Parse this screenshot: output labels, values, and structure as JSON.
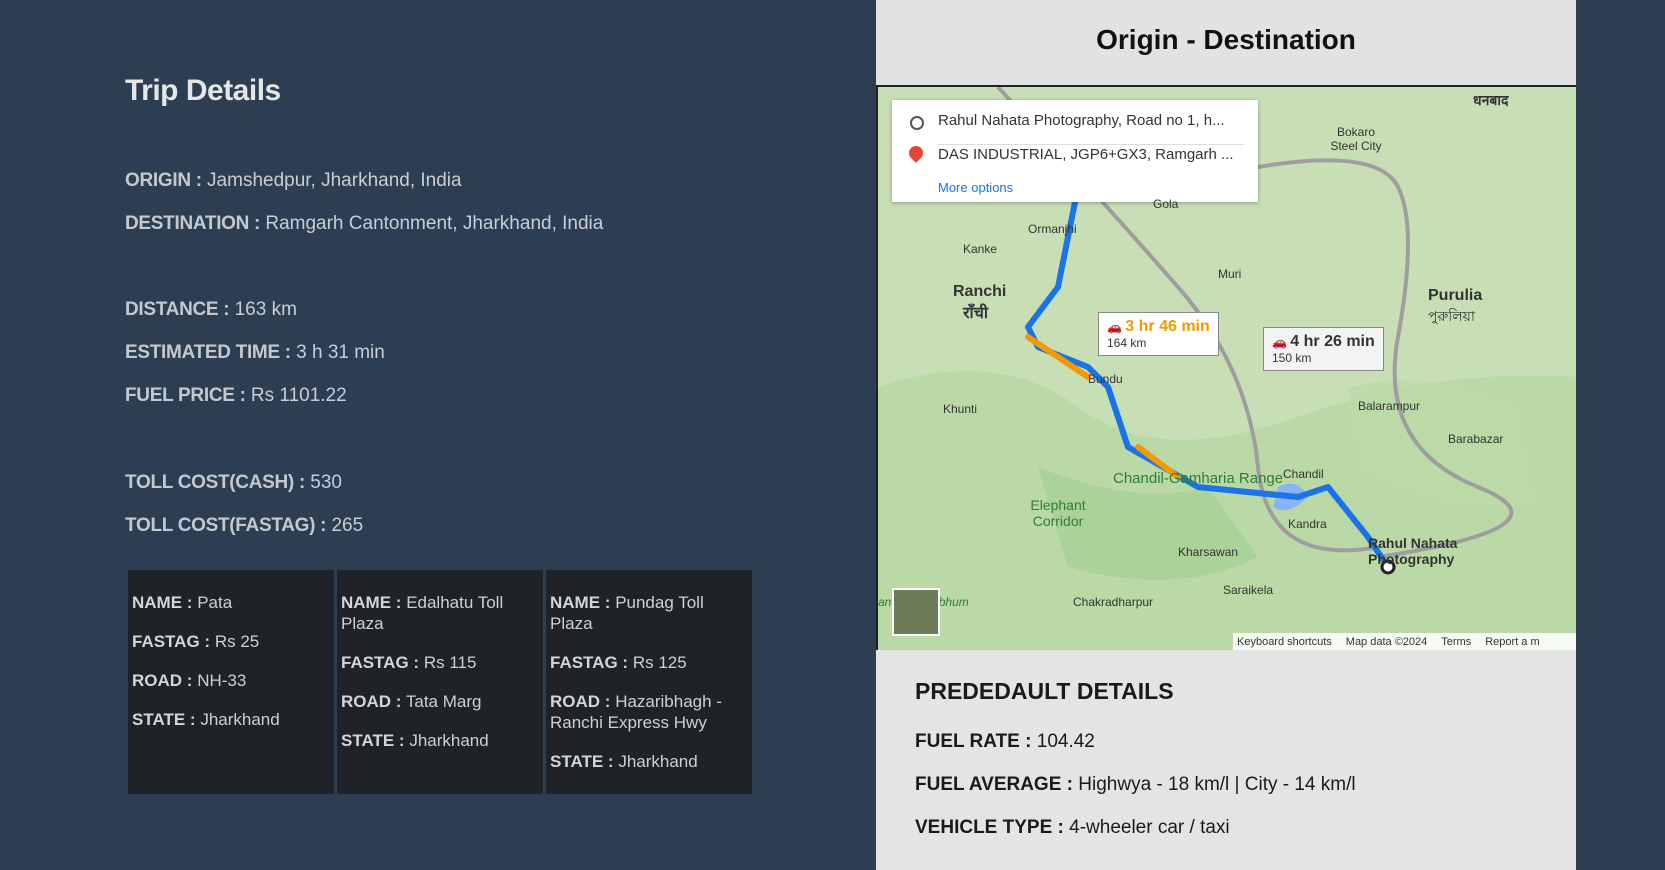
{
  "trip": {
    "title": "Trip Details",
    "origin_label": "ORIGIN :",
    "origin_value": "Jamshedpur, Jharkhand, India",
    "destination_label": "DESTINATION :",
    "destination_value": "Ramgarh Cantonment, Jharkhand, India",
    "distance_label": "DISTANCE :",
    "distance_value": "163 km",
    "time_label": "ESTIMATED TIME :",
    "time_value": "3 h 31 min",
    "fuel_label": "FUEL PRICE :",
    "fuel_value": "Rs 1101.22",
    "toll_cash_label": "TOLL COST(CASH) :",
    "toll_cash_value": "530",
    "toll_fastag_label": "TOLL COST(FASTAG) :",
    "toll_fastag_value": "265"
  },
  "toll_labels": {
    "name": "NAME :",
    "fastag": "FASTAG :",
    "road": "ROAD :",
    "state": "STATE :"
  },
  "tolls": [
    {
      "name": "Pata",
      "fastag": "Rs 25",
      "road": "NH-33",
      "state": "Jharkhand"
    },
    {
      "name": "Edalhatu Toll Plaza",
      "fastag": "Rs 115",
      "road": "Tata Marg",
      "state": "Jharkhand"
    },
    {
      "name": "Pundag Toll Plaza",
      "fastag": "Rs 125",
      "road": "Hazaribhagh - Ranchi Express Hwy",
      "state": "Jharkhand"
    }
  ],
  "map_panel": {
    "title": "Origin - Destination",
    "origin_field": "Rahul Nahata Photography, Road no 1, h...",
    "destination_field": "DAS INDUSTRIAL, JGP6+GX3, Ramgarh ...",
    "more_options": "More options",
    "route1_time": "3 hr 46 min",
    "route1_dist": "164 km",
    "route2_time": "4 hr 26 min",
    "route2_dist": "150 km",
    "places": {
      "ranchi": "Ranchi",
      "ranchi_hi": "राँची",
      "purulia": "Purulia",
      "purulia_bn": "পুরুলিয়া",
      "chandil": "Chandil",
      "bundu": "Bundu",
      "khunti": "Khunti",
      "ormanjhi": "Ormanjhi",
      "muri": "Muri",
      "gola": "Gola",
      "bokaro": "Bokaro Steel City",
      "balarampur": "Balarampur",
      "barabazar": "Barabazar",
      "kandra": "Kandra",
      "kharsawan": "Kharsawan",
      "chakradharpur": "Chakradharpur",
      "kanke": "Kanke",
      "elephant": "Elephant Corridor",
      "range": "Chandil-Gamharia Range",
      "dest_pin": "Rahul Nahata Photography",
      "dhanbad": "धनबाद",
      "singhbhum": "anda Singhbhum",
      "saraikela": "Saraikela"
    },
    "footer": {
      "shortcuts": "Keyboard shortcuts",
      "mapdata": "Map data ©2024",
      "terms": "Terms",
      "report": "Report a m"
    },
    "colors": {
      "route_primary": "#1a73e8",
      "route_traffic": "#f29900",
      "alt_route": "#9e9e9e"
    }
  },
  "predefault": {
    "title": "PREDEDAULT DETAILS",
    "fuel_rate_label": "FUEL RATE :",
    "fuel_rate_value": "104.42",
    "fuel_avg_label": "FUEL AVERAGE :",
    "fuel_avg_value": "Highwya - 18 km/l | City - 14 km/l",
    "vehicle_label": "VEHICLE TYPE :",
    "vehicle_value": "4-wheeler car / taxi"
  }
}
